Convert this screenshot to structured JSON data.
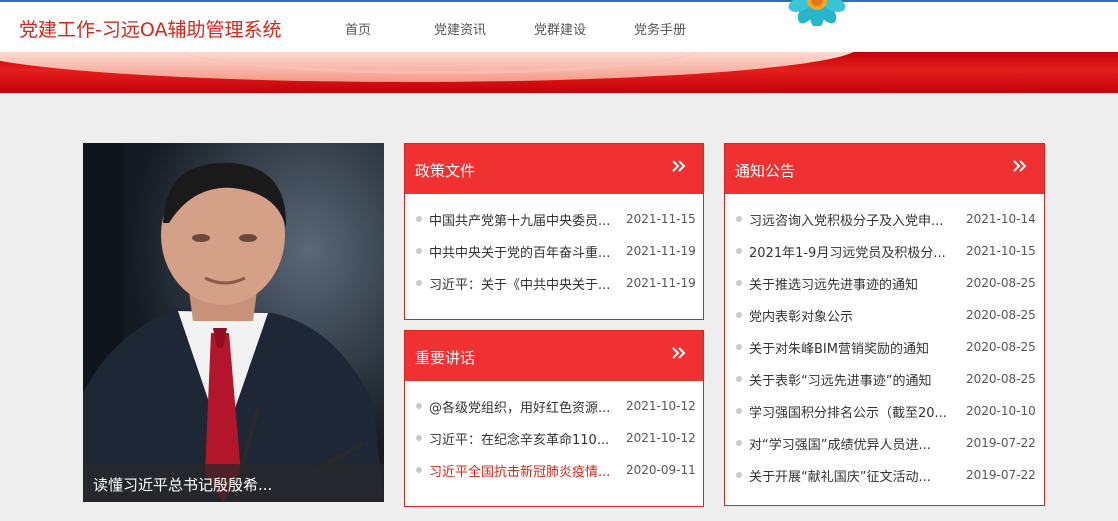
{
  "app": {
    "title": "党建工作-习远OA辅助管理系统"
  },
  "nav": {
    "items": [
      "首页",
      "党建资讯",
      "党群建设",
      "党务手册"
    ]
  },
  "photo": {
    "caption": "读懂习近平总书记殷殷希..."
  },
  "panels": {
    "policy": {
      "title": "政策文件",
      "items": [
        {
          "text": "中国共产党第十九届中央委员...",
          "date": "2021-11-15"
        },
        {
          "text": "中共中央关于党的百年奋斗重...",
          "date": "2021-11-19"
        },
        {
          "text": "习近平：关于《中共中央关于...",
          "date": "2021-11-19"
        }
      ]
    },
    "speeches": {
      "title": "重要讲话",
      "items": [
        {
          "text": "@各级党组织，用好红色资源...",
          "date": "2021-10-12"
        },
        {
          "text": "习近平：在纪念辛亥革命110...",
          "date": "2021-10-12"
        },
        {
          "text": "习近平全国抗击新冠肺炎疫情...",
          "date": "2020-09-11"
        }
      ]
    },
    "notices": {
      "title": "通知公告",
      "items": [
        {
          "text": "习远咨询入党积极分子及入党申...",
          "date": "2021-10-14"
        },
        {
          "text": "2021年1-9月习远党员及积极分...",
          "date": "2021-10-15"
        },
        {
          "text": "关于推选习远先进事迹的通知",
          "date": "2020-08-25"
        },
        {
          "text": "党内表彰对象公示",
          "date": "2020-08-25"
        },
        {
          "text": "关于对朱峰BIM营销奖励的通知",
          "date": "2020-08-25"
        },
        {
          "text": "关于表彰“习远先进事迹”的通知",
          "date": "2020-08-25"
        },
        {
          "text": "学习强国积分排名公示（截至20...",
          "date": "2020-10-10"
        },
        {
          "text": "对“学习强国”成绩优异人员进...",
          "date": "2019-07-22"
        },
        {
          "text": "关于开展“献礼国庆”征文活动...",
          "date": "2019-07-22"
        }
      ]
    }
  },
  "colors": {
    "brand_red": "#d7261b",
    "panel_head": "#ef3131",
    "accent_blue": "#2f6fb3"
  },
  "icons": {
    "more": "double-chevron-right-icon",
    "flower": "flower-decoration-icon"
  }
}
